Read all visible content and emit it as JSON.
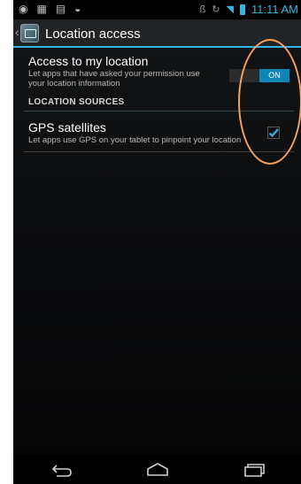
{
  "status_bar": {
    "left_icons": [
      "target-icon",
      "grid-icon",
      "clipboard-icon",
      "gamepad-icon"
    ],
    "time": "11:11 AM",
    "accent_color": "#33b5e5"
  },
  "action_bar": {
    "title": "Location access",
    "accent_color": "#33b5e5"
  },
  "settings": {
    "access": {
      "title": "Access to my location",
      "subtitle_line1": "Let apps that have asked your permission use",
      "subtitle_line2": "your location information",
      "switch_label": "ON"
    },
    "section_header": "LOCATION SOURCES",
    "gps": {
      "title": "GPS satellites",
      "subtitle": "Let apps use GPS on your tablet to pinpoint your location",
      "checked": true
    }
  },
  "nav_bar": {
    "buttons": [
      "back-icon",
      "home-icon",
      "recent-apps-icon"
    ]
  },
  "annotation": {
    "color": "#f4a15c"
  }
}
